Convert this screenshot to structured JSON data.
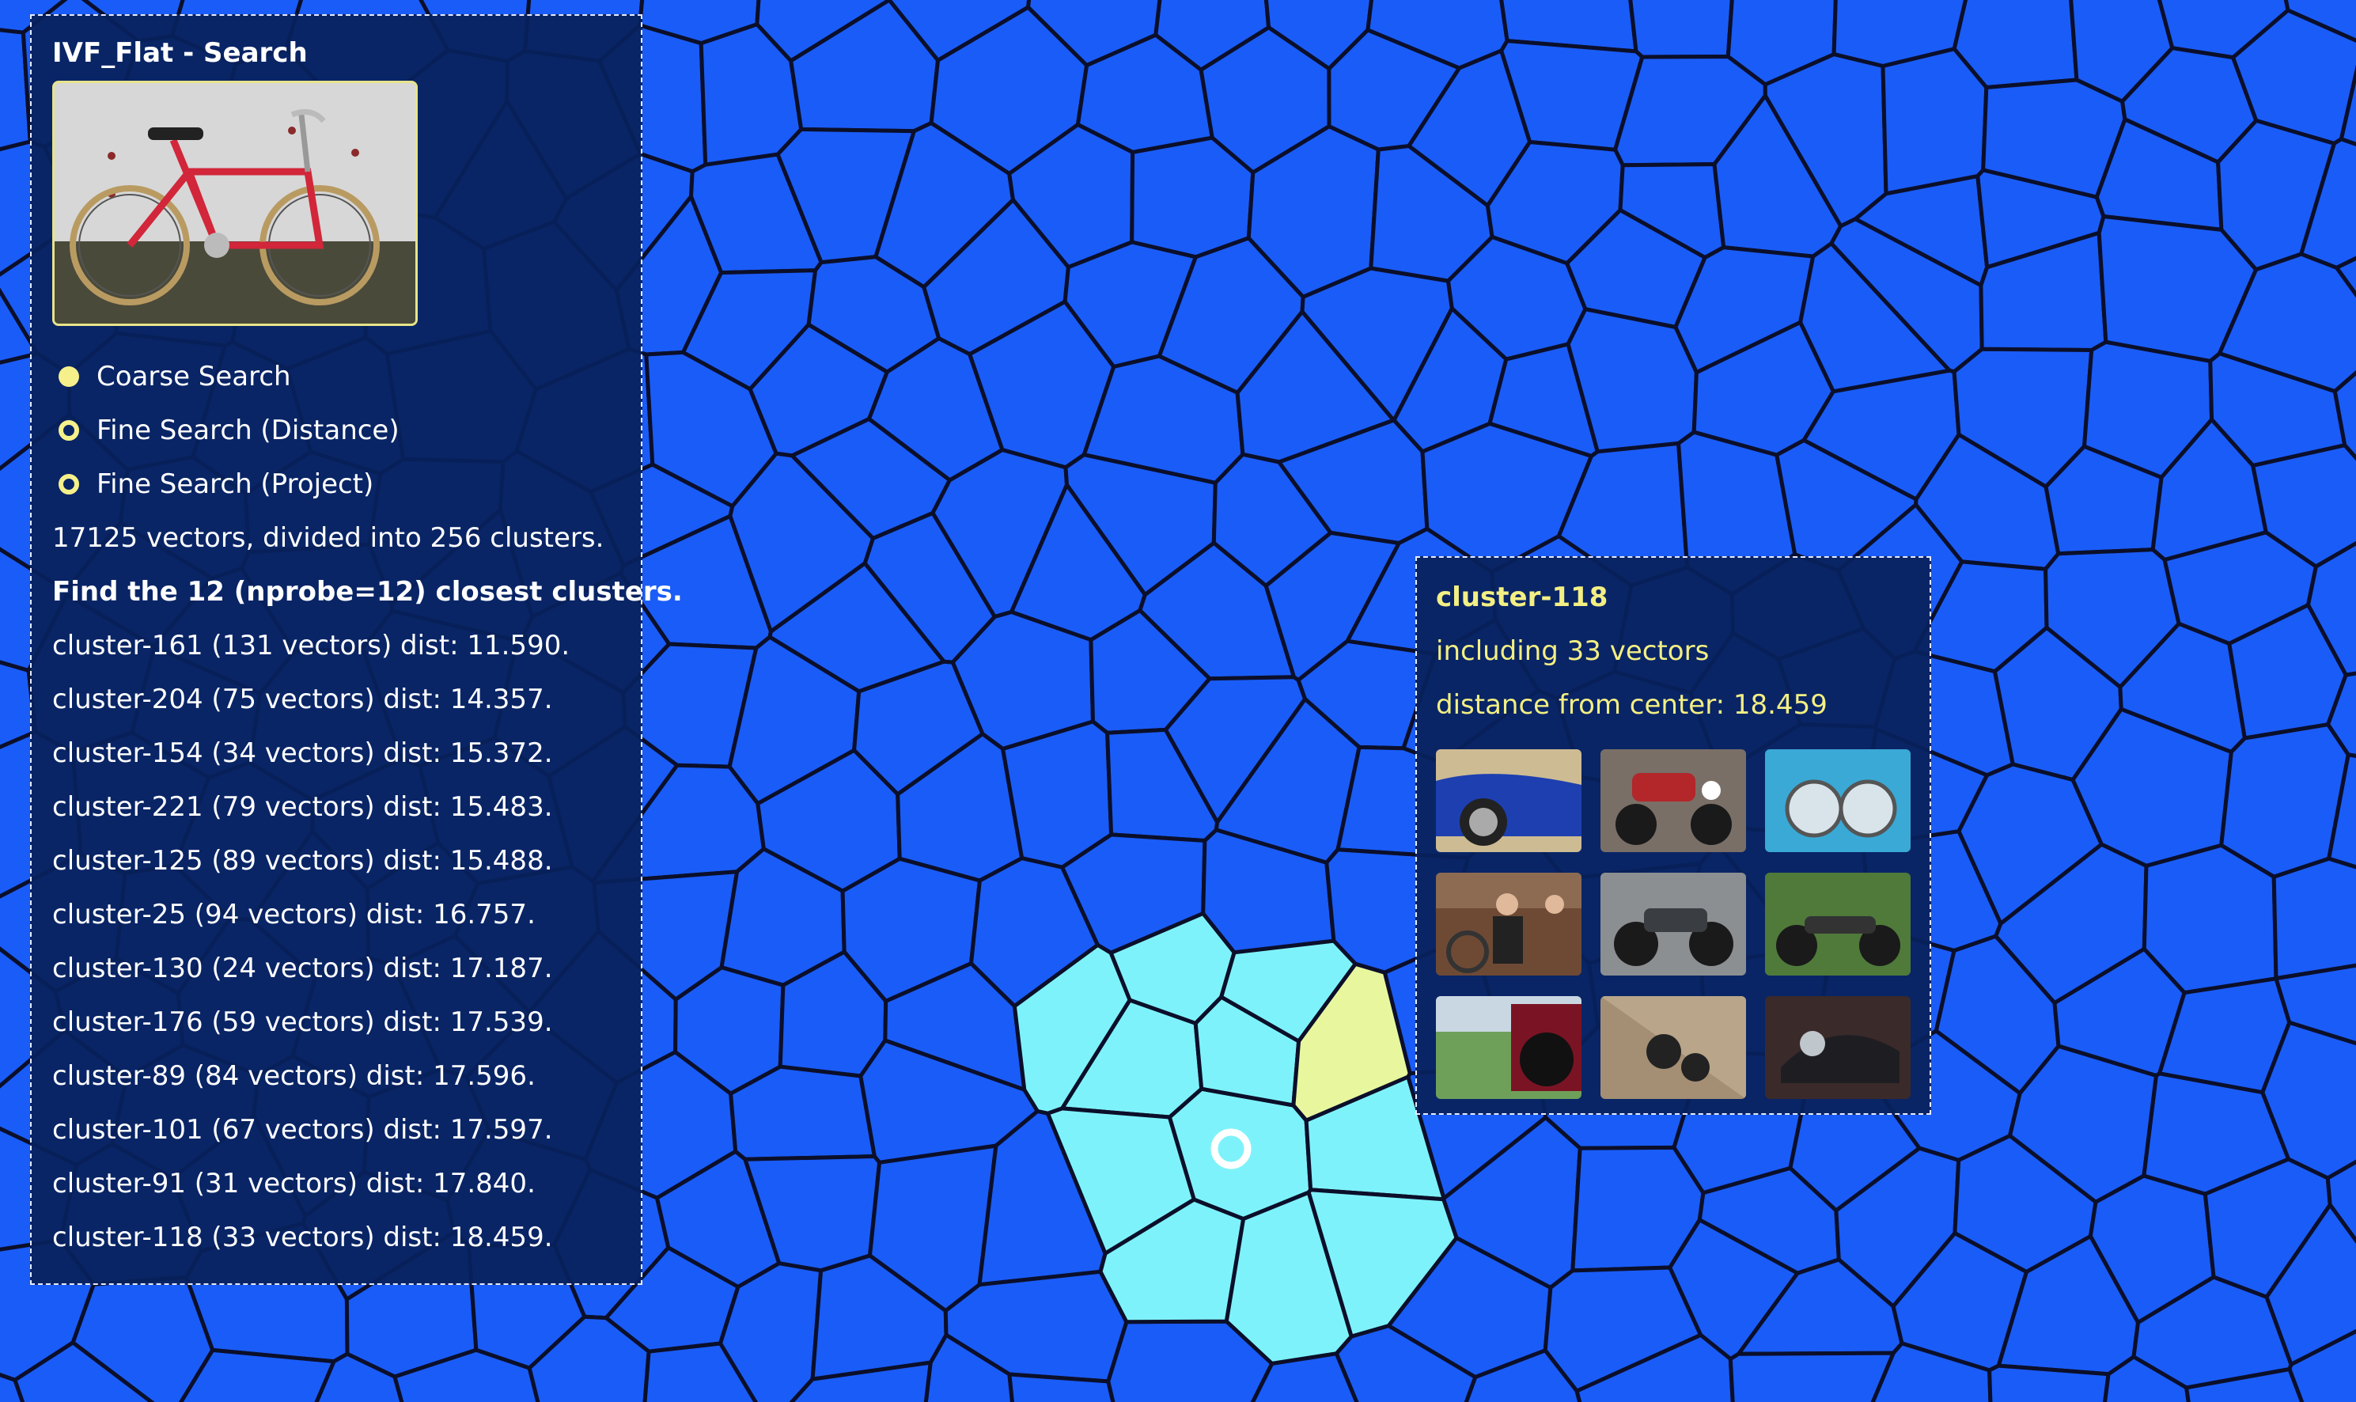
{
  "search_panel": {
    "title": "IVF_Flat - Search",
    "query_image_icon": "bicycle-photo",
    "modes": [
      {
        "label": "Coarse Search",
        "selected": true
      },
      {
        "label": "Fine Search (Distance)",
        "selected": false
      },
      {
        "label": "Fine Search (Project)",
        "selected": false
      }
    ],
    "summary": "17125 vectors, divided into 256 clusters.",
    "nprobe_heading": "Find the 12 (nprobe=12) closest clusters.",
    "results": [
      "cluster-161 (131 vectors) dist: 11.590.",
      "cluster-204 (75 vectors) dist: 14.357.",
      "cluster-154 (34 vectors) dist: 15.372.",
      "cluster-221 (79 vectors) dist: 15.483.",
      "cluster-125 (89 vectors) dist: 15.488.",
      "cluster-25 (94 vectors) dist: 16.757.",
      "cluster-130 (24 vectors) dist: 17.187.",
      "cluster-176 (59 vectors) dist: 17.539.",
      "cluster-89 (84 vectors) dist: 17.596.",
      "cluster-101 (67 vectors) dist: 17.597.",
      "cluster-91 (31 vectors) dist: 17.840.",
      "cluster-118 (33 vectors) dist: 18.459."
    ]
  },
  "cluster_panel": {
    "title": "cluster-118",
    "count_text": "including 33 vectors",
    "distance_text": "distance from center: 18.459",
    "thumbnails": [
      "blue-car-photo",
      "red-motorcycle-photo",
      "car-headlights-photo",
      "people-carriage-photo",
      "motorcycle-photo",
      "cruiser-motorcycle-photo",
      "truck-wheel-photo",
      "motorcycle-rider-photo",
      "black-motorcycle-photo"
    ]
  },
  "colors": {
    "background": "#1a5cf7",
    "cell": "#1a5cf7",
    "cell_selected": "#7ef2fa",
    "cell_highlight": "#e8f79e",
    "cell_border": "#0b0f2a",
    "accent_text": "#f3ef83",
    "panel_bg": "#09225c"
  }
}
